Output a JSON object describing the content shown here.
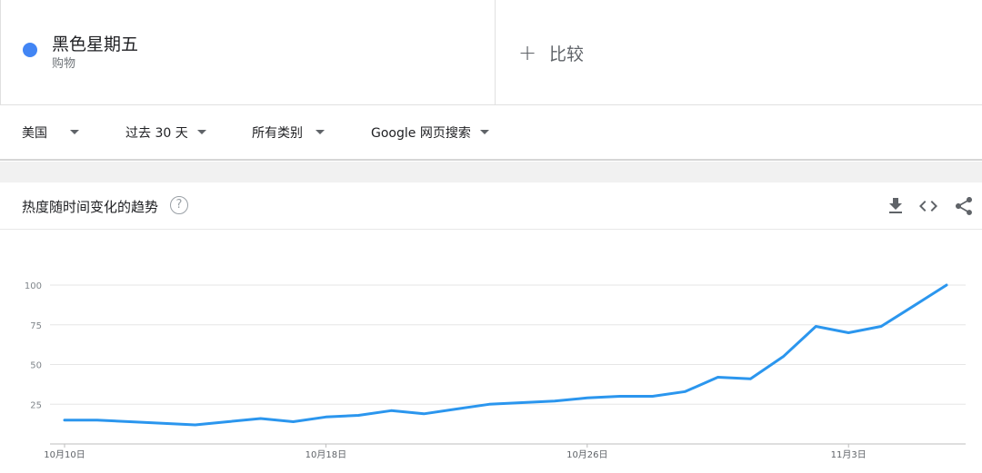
{
  "term": {
    "name": "黑色星期五",
    "category": "购物",
    "color": "#4285f4"
  },
  "compare": {
    "icon": "plus-icon",
    "label": "比较"
  },
  "filters": {
    "country": "美国",
    "time_range": "过去 30 天",
    "category": "所有类别",
    "property": "Google 网页搜索"
  },
  "card": {
    "title": "热度随时间变化的趋势",
    "help_icon": "?",
    "tools": [
      "download-icon",
      "embed-icon",
      "share-icon"
    ]
  },
  "chart_data": {
    "type": "line",
    "title": "",
    "xlabel": "",
    "ylabel": "",
    "ylim": [
      0,
      100
    ],
    "y_ticks": [
      25,
      50,
      75,
      100
    ],
    "x_tick_labels": [
      "10月10日",
      "10月18日",
      "10月26日",
      "11月3日"
    ],
    "grid": true,
    "series": [
      {
        "color": "#2b96ee",
        "x": [
          "10月10日",
          "10月11日",
          "10月12日",
          "10月13日",
          "10月14日",
          "10月15日",
          "10月16日",
          "10月17日",
          "10月18日",
          "10月19日",
          "10月20日",
          "10月21日",
          "10月22日",
          "10月23日",
          "10月24日",
          "10月25日",
          "10月26日",
          "10月27日",
          "10月28日",
          "10月29日",
          "10月30日",
          "10月31日",
          "11月1日",
          "11月2日",
          "11月3日",
          "11月4日",
          "11月5日",
          "11月6日"
        ],
        "values": [
          15,
          15,
          14,
          13,
          12,
          14,
          16,
          14,
          17,
          18,
          21,
          19,
          22,
          25,
          26,
          27,
          29,
          30,
          30,
          33,
          42,
          41,
          55,
          74,
          70,
          74,
          87,
          100
        ]
      }
    ]
  }
}
